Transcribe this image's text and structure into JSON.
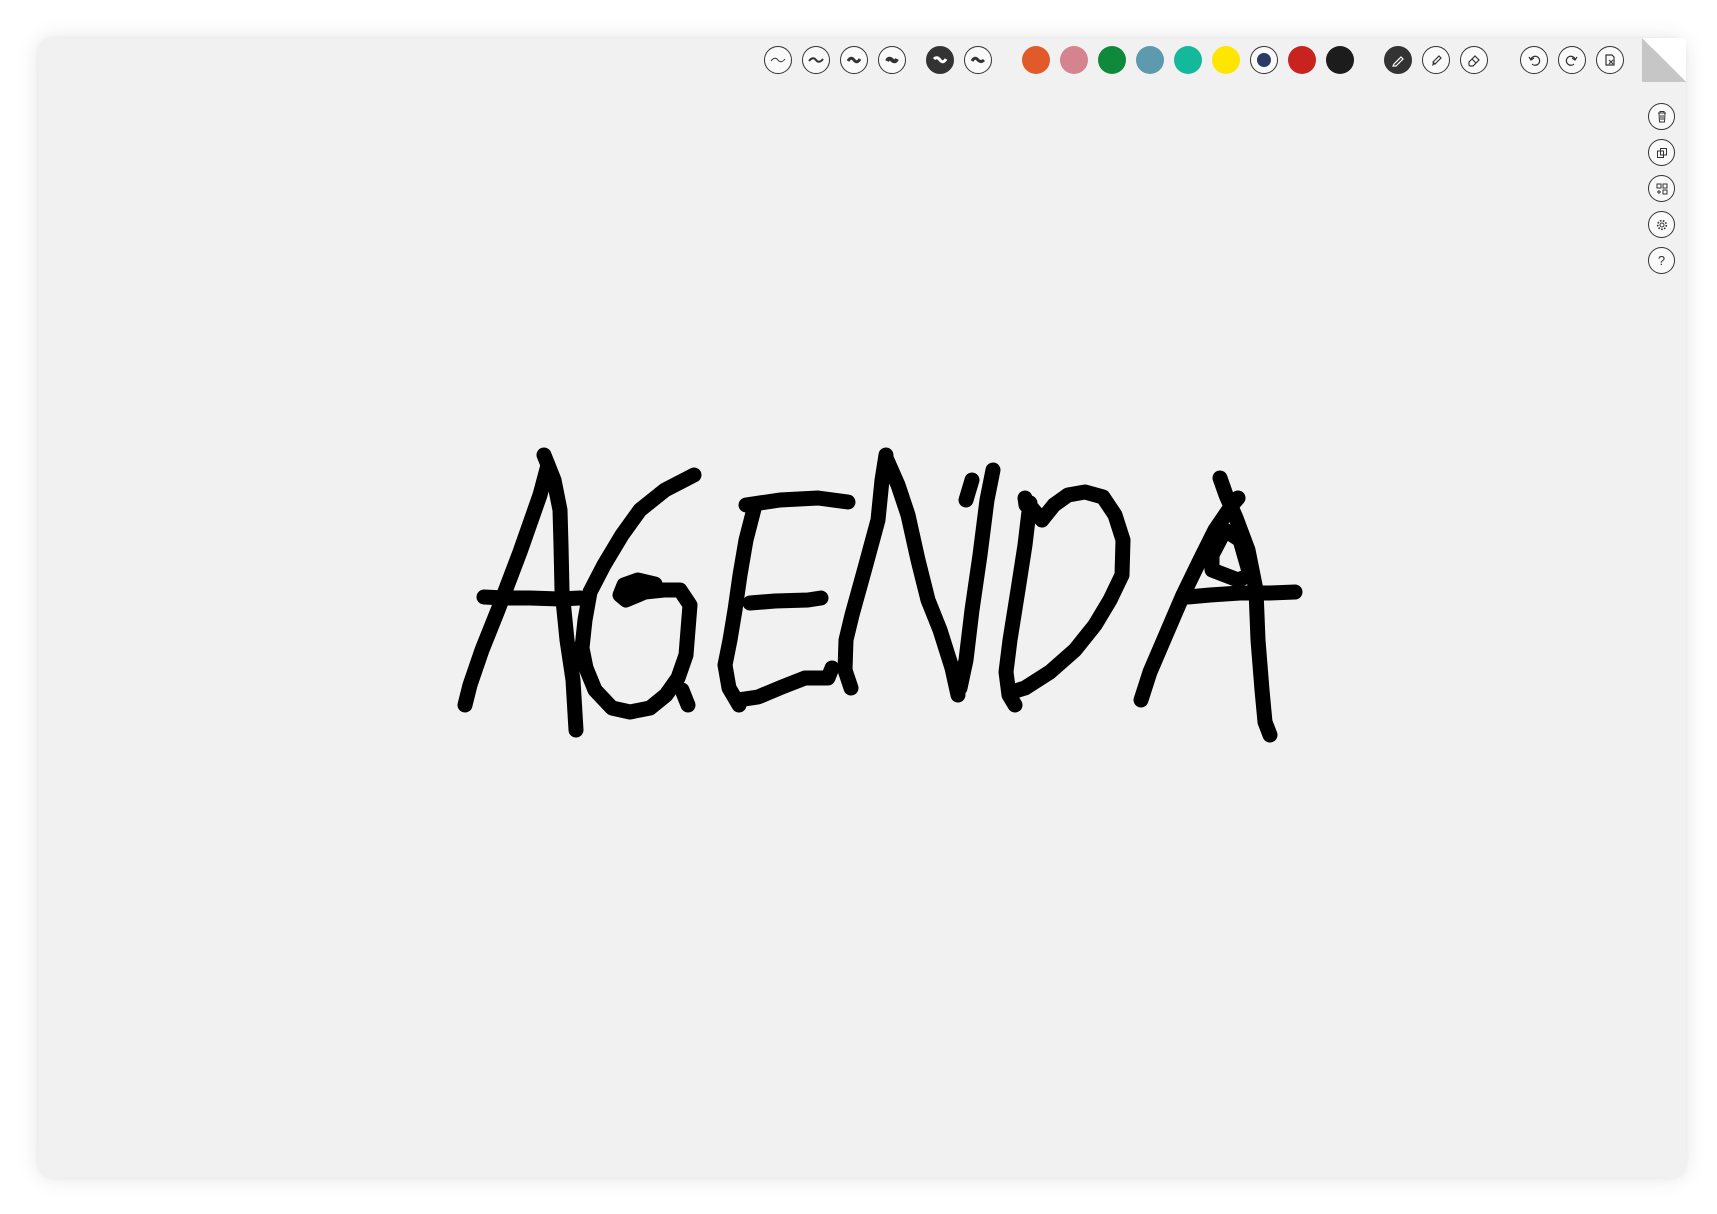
{
  "toolbar": {
    "stroke_widths": [
      {
        "name": "stroke-width-1",
        "selected": false
      },
      {
        "name": "stroke-width-2",
        "selected": false
      },
      {
        "name": "stroke-width-3",
        "selected": false
      },
      {
        "name": "stroke-width-4",
        "selected": false
      },
      {
        "name": "stroke-width-5",
        "selected": true
      },
      {
        "name": "stroke-width-6",
        "selected": false
      }
    ],
    "colors": [
      "#e05a2b",
      "#d4838f",
      "#0f8a3c",
      "#5e9aad",
      "#14b89a",
      "#ffe600",
      "#2c3a66",
      "#c8231f",
      "#1c1c1c"
    ],
    "selected_color": "#2c3a66",
    "tools": [
      "pen-icon",
      "highlighter-icon",
      "eraser-icon"
    ],
    "selected_tool": "pen-icon",
    "history": [
      "undo-icon",
      "redo-icon",
      "clear-icon"
    ]
  },
  "side_tools": [
    "trash-icon",
    "duplicate-icon",
    "add-board-icon",
    "settings-icon",
    "help-icon"
  ],
  "canvas": {
    "handwritten_text": "AGENDA",
    "ink_color": "#000000"
  }
}
